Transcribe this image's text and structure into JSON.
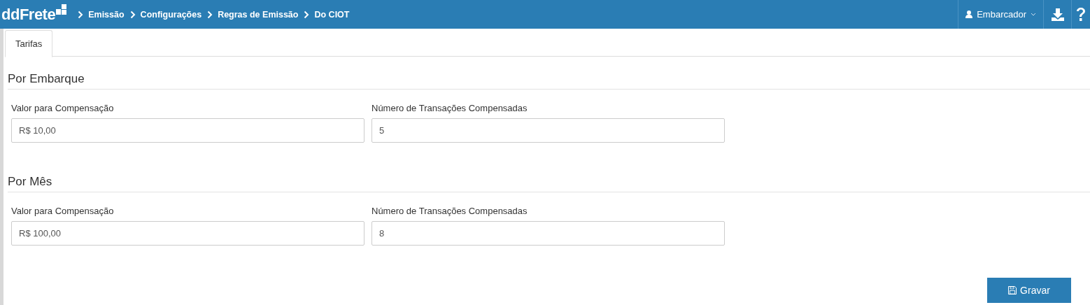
{
  "header": {
    "logo": "ddFrete",
    "breadcrumbs": [
      "Emissão",
      "Configurações",
      "Regras de Emissão",
      "Do CIOT"
    ],
    "user": "Embarcador"
  },
  "tabs": [
    {
      "label": "Tarifas",
      "selected": true
    }
  ],
  "sections": [
    {
      "title": "Por Embarque",
      "fields": [
        {
          "label": "Valor para Compensação",
          "value": "R$ 10,00"
        },
        {
          "label": "Número de Transações Compensadas",
          "value": "5"
        }
      ]
    },
    {
      "title": "Por Mês",
      "fields": [
        {
          "label": "Valor para Compensação",
          "value": "R$ 100,00"
        },
        {
          "label": "Número de Transações Compensadas",
          "value": "8"
        }
      ]
    }
  ],
  "save_button": "Gravar"
}
